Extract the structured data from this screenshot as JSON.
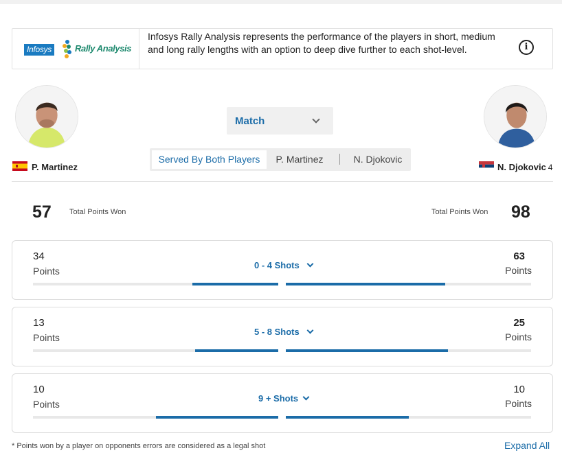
{
  "colors": {
    "accent": "#1b6ca8",
    "bar_track": "#e8e8e8",
    "infosys_blue": "#1a7bc1",
    "rally_green": "#1f8a6f"
  },
  "banner": {
    "logo_brand": "Infosys",
    "logo_product": "Rally Analysis",
    "description": "Infosys Rally Analysis represents the performance of the players in short, medium and long rally lengths with an option to deep dive further to each shot-level.",
    "info_icon": "info-icon"
  },
  "players": {
    "left": {
      "name": "P. Martinez",
      "flag": "spain-flag-icon",
      "seed": ""
    },
    "right": {
      "name": "N. Djokovic",
      "flag": "serbia-flag-icon",
      "seed": "4"
    }
  },
  "filter": {
    "selected": "Match",
    "icon": "chevron-down-icon"
  },
  "tabs": [
    {
      "label": "Served By Both Players",
      "active": true
    },
    {
      "label": "P. Martinez",
      "active": false
    },
    {
      "label": "N. Djokovic",
      "active": false
    }
  ],
  "totals": {
    "left_value": "57",
    "left_label": "Total Points Won",
    "right_value": "98",
    "right_label": "Total Points Won"
  },
  "rallies": [
    {
      "title": "0 - 4 Shots",
      "left_points": "34",
      "left_label": "Points",
      "right_points": "63",
      "right_label": "Points",
      "left_fill": 0.35,
      "right_fill": 0.65,
      "right_bold": true
    },
    {
      "title": "5 - 8 Shots",
      "left_points": "13",
      "left_label": "Points",
      "right_points": "25",
      "right_label": "Points",
      "left_fill": 0.34,
      "right_fill": 0.66,
      "right_bold": true
    },
    {
      "title": "9 + Shots",
      "left_points": "10",
      "left_label": "Points",
      "right_points": "10",
      "right_label": "Points",
      "left_fill": 0.5,
      "right_fill": 0.5,
      "right_bold": false
    }
  ],
  "footer": {
    "note": "* Points won by a player on opponents errors are considered as a legal shot",
    "expand_all": "Expand All"
  }
}
